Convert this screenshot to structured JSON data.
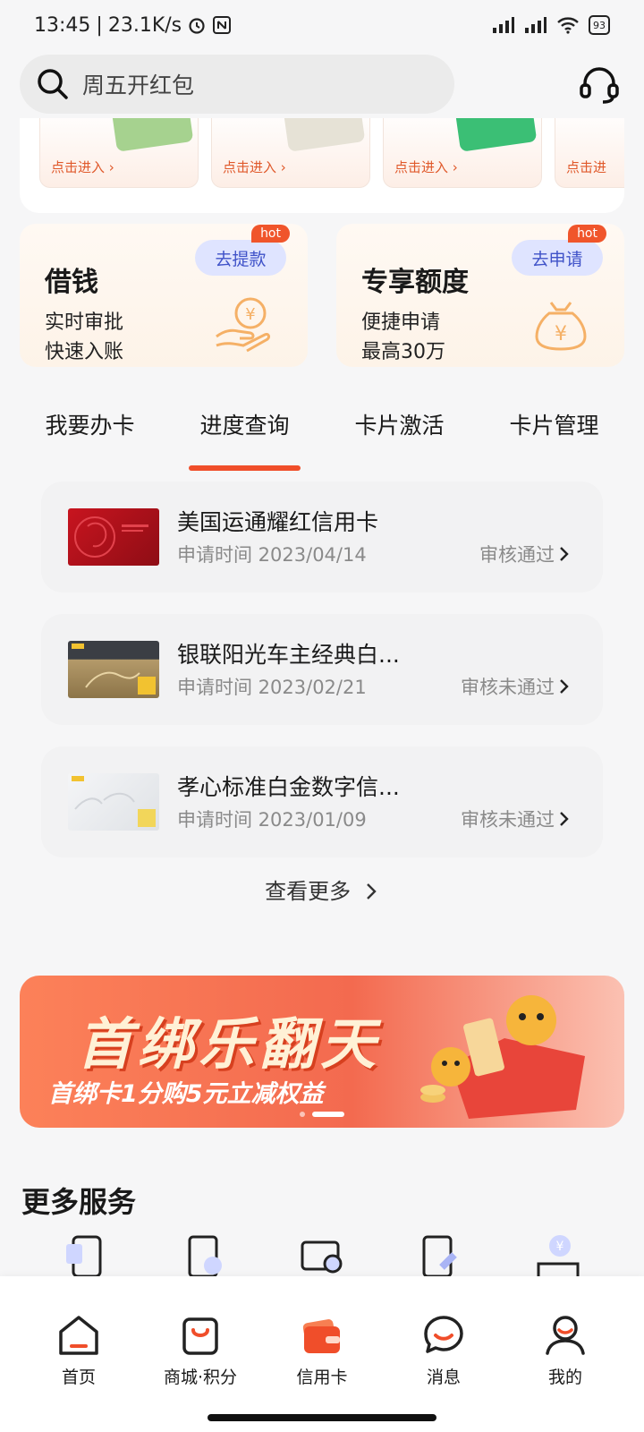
{
  "status_bar": {
    "time": "13:45",
    "separator": "|",
    "net_speed": "23.1K/s",
    "battery": "93"
  },
  "search": {
    "placeholder": "周五开红包"
  },
  "mini_cards": [
    {
      "label": "点击进入",
      "color": "#9fd08a"
    },
    {
      "label": "点击进入",
      "color": "#e8e4d8"
    },
    {
      "label": "点击进入",
      "color": "#3bbf75"
    },
    {
      "label": "点击进",
      "color": "#f0e8e0"
    }
  ],
  "promos": [
    {
      "title": "借钱",
      "line1": "实时审批",
      "line2": "快速入账",
      "button": "去提款",
      "badge": "hot"
    },
    {
      "title": "专享额度",
      "line1": "便捷申请",
      "line2": "最高30万",
      "button": "去申请",
      "badge": "hot"
    }
  ],
  "tabs": [
    {
      "label": "我要办卡",
      "active": false
    },
    {
      "label": "进度查询",
      "active": true
    },
    {
      "label": "卡片激活",
      "active": false
    },
    {
      "label": "卡片管理",
      "active": false
    }
  ],
  "applications": [
    {
      "name": "美国运通耀红信用卡",
      "date": "申请时间 2023/04/14",
      "status": "审核通过",
      "card_color": "#b3121d"
    },
    {
      "name": "银联阳光车主经典白...",
      "date": "申请时间 2023/02/21",
      "status": "审核未通过",
      "card_color": "#6b5a3c"
    },
    {
      "name": "孝心标准白金数字信...",
      "date": "申请时间 2023/01/09",
      "status": "审核未通过",
      "card_color": "#e9ebee"
    }
  ],
  "see_more": "查看更多",
  "banner": {
    "title": "首绑乐翻天",
    "subtitle": "首绑卡1分购5元立减权益"
  },
  "more_services_title": "更多服务",
  "bottom_nav": [
    {
      "label": "首页",
      "icon": "home-icon"
    },
    {
      "label": "商城·积分",
      "icon": "shopping-bag-icon"
    },
    {
      "label": "信用卡",
      "icon": "credit-card-wallet-icon"
    },
    {
      "label": "消息",
      "icon": "message-icon"
    },
    {
      "label": "我的",
      "icon": "profile-icon"
    }
  ],
  "colors": {
    "accent": "#f04e2a",
    "button_bg": "#dfe4ff",
    "button_text": "#3f52c8"
  }
}
